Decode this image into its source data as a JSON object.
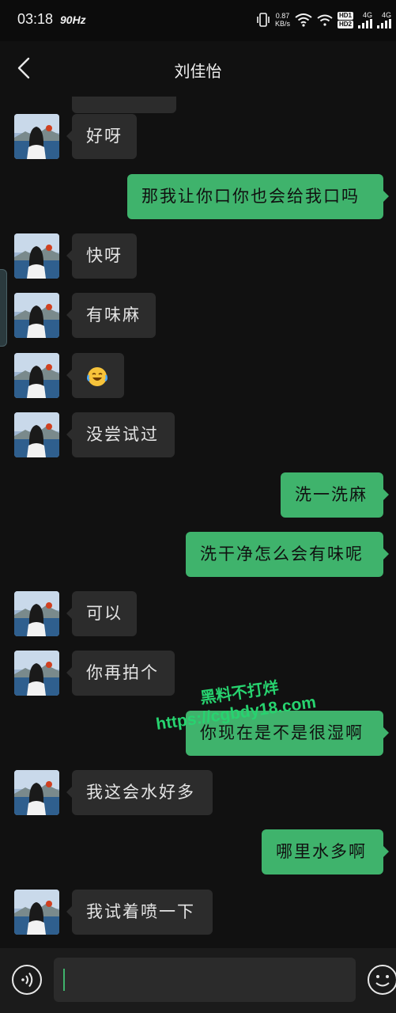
{
  "status_bar": {
    "time": "03:18",
    "refresh_rate": "90Hz",
    "net_speed_value": "0.87",
    "net_speed_unit": "KB/s",
    "hd_badge_1": "HD1",
    "hd_badge_2": "HD2",
    "network_1": "4G",
    "network_2": "4G"
  },
  "header": {
    "title": "刘佳怡",
    "back_icon": "chevron-left-icon"
  },
  "messages": [
    {
      "side": "in",
      "text": "好呀"
    },
    {
      "side": "out",
      "text": "那我让你口你也会给我口吗"
    },
    {
      "side": "in",
      "text": "快呀"
    },
    {
      "side": "in",
      "text": "有味麻"
    },
    {
      "side": "in",
      "text": "",
      "emoji": "laughing-crying-emoji"
    },
    {
      "side": "in",
      "text": "没尝试过"
    },
    {
      "side": "out",
      "text": "洗一洗麻"
    },
    {
      "side": "out",
      "text": "洗干净怎么会有味呢"
    },
    {
      "side": "in",
      "text": "可以"
    },
    {
      "side": "in",
      "text": "你再拍个"
    },
    {
      "side": "out",
      "text": "你现在是不是很湿啊"
    },
    {
      "side": "in",
      "text": "我这会水好多"
    },
    {
      "side": "out",
      "text": "哪里水多啊"
    },
    {
      "side": "in",
      "text": "我试着喷一下"
    }
  ],
  "watermark": {
    "line1": "黑料不打烊",
    "line2": "https://cgbdy18.com"
  },
  "input_bar": {
    "voice_icon": "voice-input-icon",
    "text_value": "",
    "emoji_icon": "smiley-face-icon"
  },
  "colors": {
    "background": "#111111",
    "incoming_bubble": "#2c2c2c",
    "outgoing_bubble": "#3fb36c",
    "watermark": "#27d36f"
  }
}
